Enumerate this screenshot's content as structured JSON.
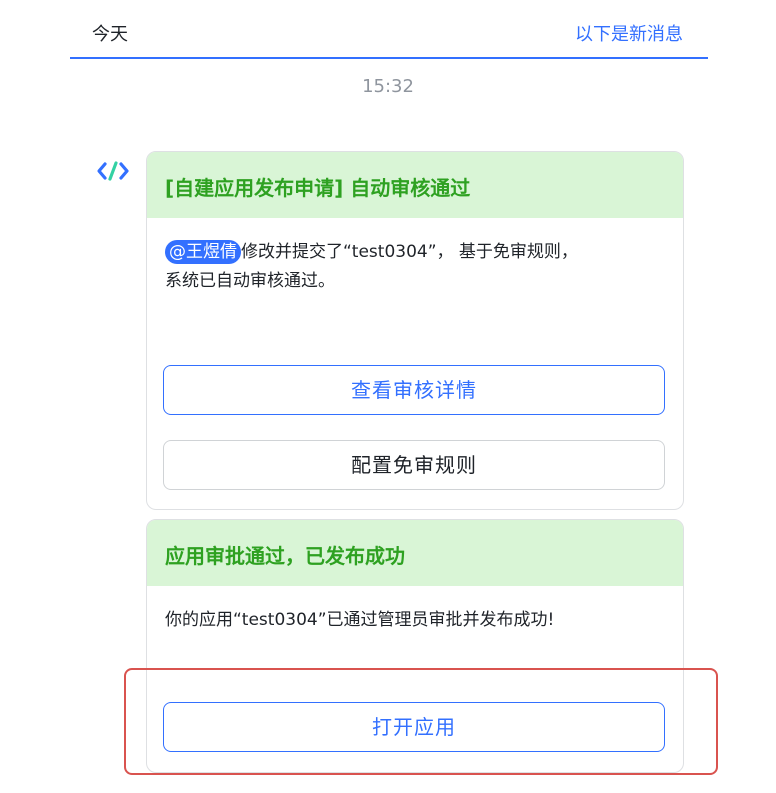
{
  "header": {
    "today_label": "今天",
    "new_messages_label": "以下是新消息"
  },
  "timestamp": "15:32",
  "bot_icon": "code-bracket-icon",
  "card1": {
    "title": "[自建应用发布申请] 自动审核通过",
    "mention": "@王煜倩",
    "body_line1": "修改并提交了“test0304”， 基于免审规则，",
    "body_line2": "系统已自动审核通过。",
    "view_button": "查看审核详情",
    "config_button": "配置免审规则"
  },
  "card2": {
    "title": "应用审批通过，已发布成功",
    "body": "你的应用“test0304”已通过管理员审批并发布成功!",
    "open_button": "打开应用"
  },
  "colors": {
    "accent": "#3370ff",
    "header_green_bg": "#d9f5d6",
    "title_green": "#2ea121",
    "highlight_red": "#d9534f"
  }
}
